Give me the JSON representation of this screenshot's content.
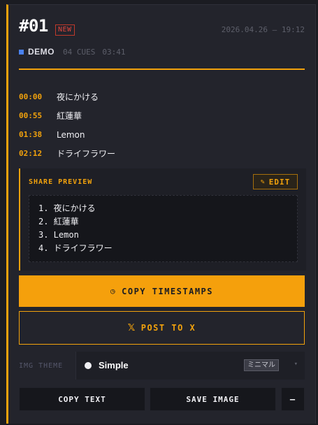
{
  "header": {
    "title": "#01",
    "badge": "NEW",
    "datetime": "2026.04.26 — 19:12",
    "tag": "DEMO",
    "cues": "04 CUES",
    "duration": "03:41",
    "accent": "#f2a20c"
  },
  "tracks": [
    {
      "time": "00:00",
      "name": "夜にかける"
    },
    {
      "time": "00:55",
      "name": "紅蓮華"
    },
    {
      "time": "01:38",
      "name": "Lemon"
    },
    {
      "time": "02:12",
      "name": "ドライフラワー"
    }
  ],
  "share": {
    "label": "SHARE PREVIEW",
    "edit_label": "EDIT",
    "edit_icon": "pencil-icon",
    "lines": [
      "1. 夜にかける",
      "2. 紅蓮華",
      "3. Lemon",
      "4. ドライフラワー"
    ]
  },
  "actions": {
    "copy_timestamps": "COPY TIMESTAMPS",
    "copy_icon": "clock-icon",
    "post_x": "POST TO X",
    "x_icon": "x-logo-icon"
  },
  "theme": {
    "label": "IMG THEME",
    "selected": "Simple",
    "tag": "ミニマル"
  },
  "bottom": {
    "copy_text": "COPY TEXT",
    "save_image": "SAVE IMAGE",
    "more": "—"
  }
}
